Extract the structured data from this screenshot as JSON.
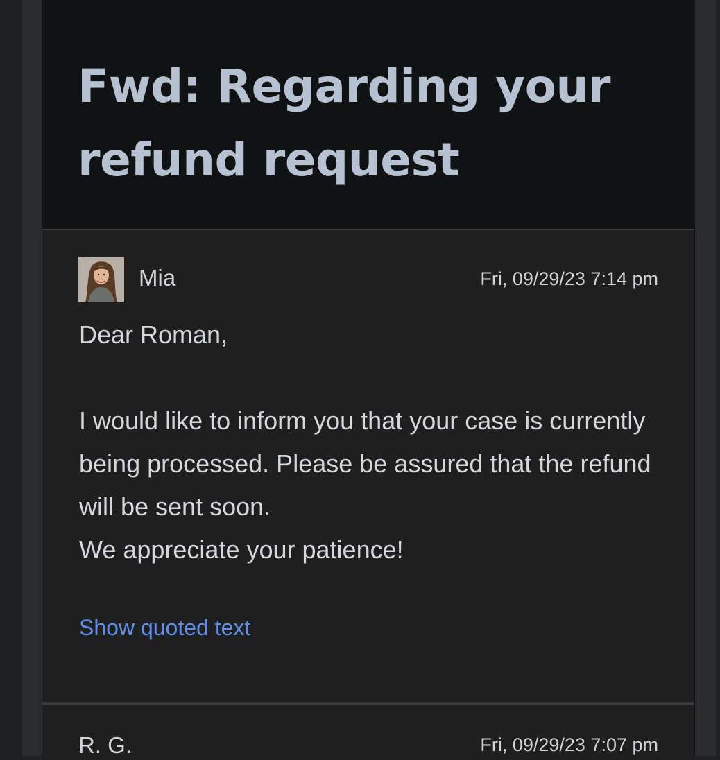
{
  "thread": {
    "subject": "Fwd: Regarding your refund request"
  },
  "messages": [
    {
      "sender": "Mia",
      "avatar_icon": "person-photo-icon",
      "date": "Fri, 09/29/23 7:14 pm",
      "greeting": "Dear Roman,",
      "body_line_1": "I would like to inform you that your case is currently being processed. Please be assured that the refund will be sent soon.",
      "body_line_2": "We appreciate your patience!",
      "show_quoted_label": "Show quoted text"
    },
    {
      "sender": "R. G.",
      "date": "Fri, 09/29/23 7:07 pm"
    }
  ],
  "colors": {
    "background": "#111213",
    "card": "#1f1f20",
    "subject_text": "#b6c2d1",
    "link": "#5f8fe8"
  }
}
